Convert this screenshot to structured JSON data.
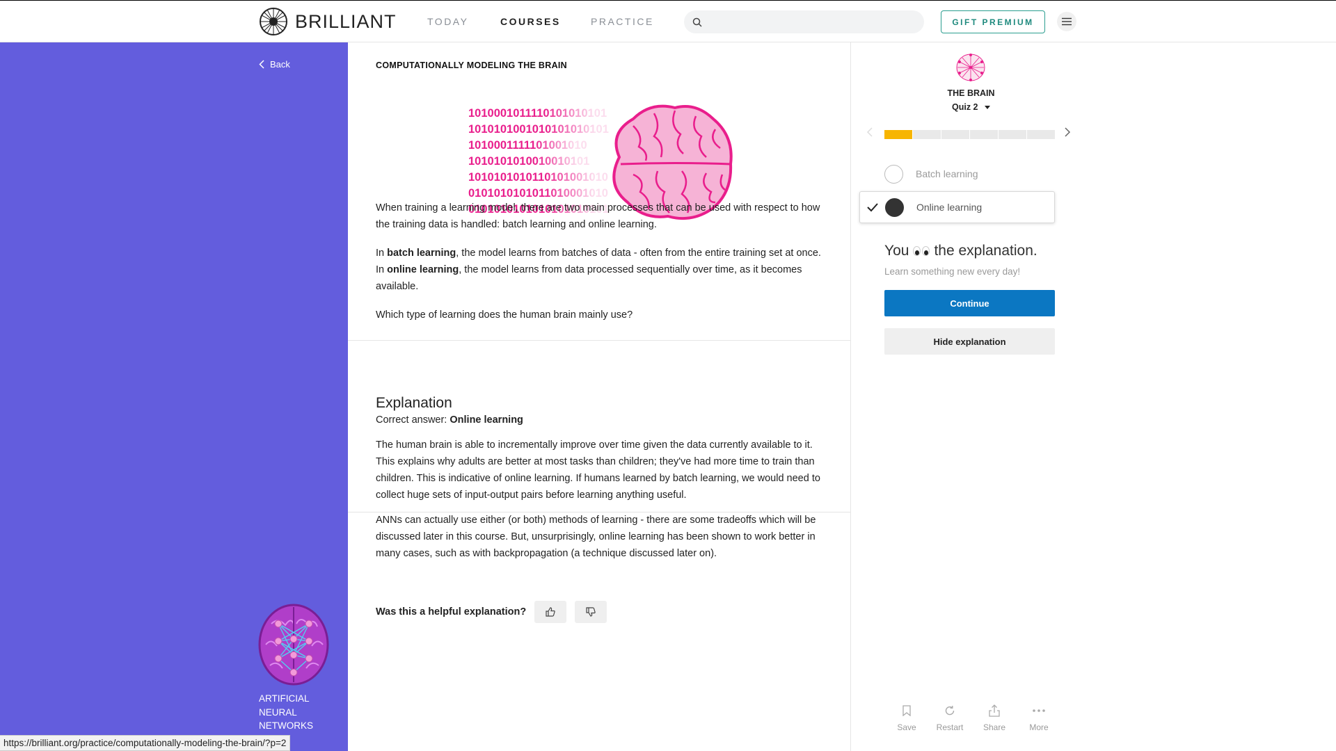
{
  "header": {
    "brand": "BRILLIANT",
    "nav": [
      "TODAY",
      "COURSES",
      "PRACTICE"
    ],
    "active_nav": "COURSES",
    "search_placeholder": "",
    "gift_label": "GIFT PREMIUM"
  },
  "sidebar": {
    "back_label": "Back",
    "course_name": "ARTIFICIAL NEURAL NETWORKS"
  },
  "main": {
    "title": "COMPUTATIONALLY MODELING THE BRAIN",
    "binary_lines": [
      "1010001011110101010101",
      "1010101001010101010101",
      "1010001111101001010",
      "1010101010010010101",
      "1010101010110101001010",
      "0101010101011010001010",
      "0101010101010101010101"
    ],
    "para1": "When training a learning model, there are two main processes that can be used with respect to how the training data is handled: batch learning and online learning.",
    "para2_a": "In ",
    "para2_b": "batch learning",
    "para2_c": ", the model learns from batches of data - often from the entire training set at once. In ",
    "para2_d": "online learning",
    "para2_e": ", the model learns from data processed sequentially over time, as it becomes available.",
    "question": "Which type of learning does the human brain mainly use?",
    "explanation_heading": "Explanation",
    "correct_label": "Correct answer: ",
    "correct_value": "Online learning",
    "exp_para1": "The human brain is able to incrementally improve over time given the data currently available to it. This explains why adults are better at most tasks than children; they've had more time to train than children. This is indicative of online learning. If humans learned by batch learning, we would need to collect huge sets of input-output pairs before learning anything useful.",
    "exp_para2": "ANNs can actually use either (or both) methods of learning - there are some tradeoffs which will be discussed later in this course. But, unsurprisingly, online learning has been shown to work better in many cases, such as with backpropagation (a technique discussed later on).",
    "helpful_label": "Was this a helpful explanation?"
  },
  "panel": {
    "chapter": "THE BRAIN",
    "quiz": "Quiz 2",
    "progress_total": 6,
    "progress_done": 1,
    "options": [
      "Batch learning",
      "Online learning"
    ],
    "selected_option": "Online learning",
    "result_you": "You",
    "result_rest": "the explanation.",
    "result_sub": "Learn something new every day!",
    "continue_label": "Continue",
    "hide_label": "Hide explanation",
    "tools": [
      "Save",
      "Restart",
      "Share",
      "More"
    ]
  },
  "status_url": "https://brilliant.org/practice/computationally-modeling-the-brain/?p=2",
  "colors": {
    "sidebar": "#635ddd",
    "accent_blue": "#0b77c2",
    "progress": "#f7b500",
    "brand_teal": "#2a9d8f",
    "brain_pink": "#e91e8c"
  }
}
